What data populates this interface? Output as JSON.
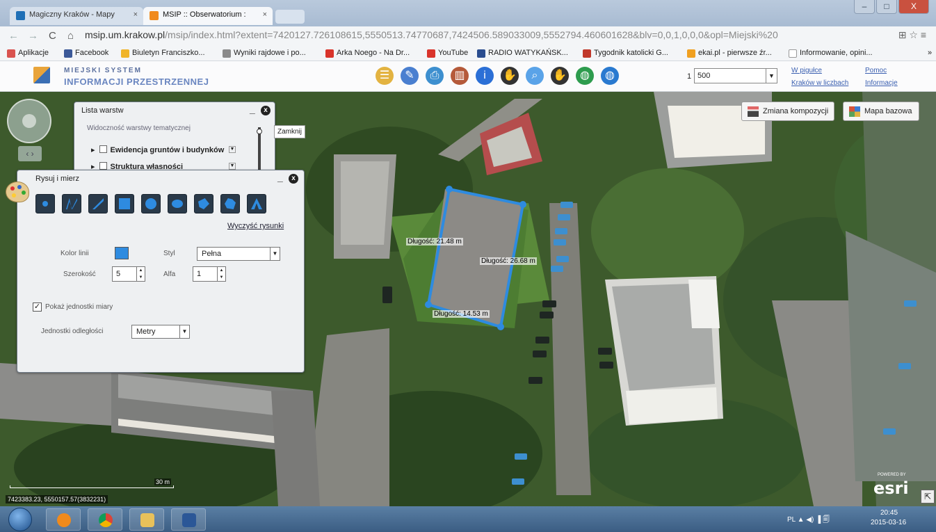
{
  "browser": {
    "tabs": [
      {
        "label": "Magiczny Kraków - Mapy",
        "close": "×"
      },
      {
        "label": "MSIP :: Obserwatorium :",
        "close": "×"
      }
    ],
    "window_buttons": {
      "minimize": "–",
      "maximize": "□",
      "close": "X"
    },
    "nav": {
      "back": "←",
      "forward": "→",
      "reload": "C",
      "home": "⌂"
    },
    "url_host": "msip.um.krakow.pl",
    "url_path": "/msip/index.html?extent=7420127.726108615,5550513.74770687,7424506.589033009,5552794.460601628&blv=0,0,1,0,0,0&opl=Miejski%20",
    "url_icons": "⊞ ☆ ≡",
    "bookmarks": [
      {
        "label": "Aplikacje",
        "color": "#d9534f"
      },
      {
        "label": "Facebook",
        "color": "#3b5998"
      },
      {
        "label": "Biuletyn Franciszko...",
        "color": "#f0b429"
      },
      {
        "label": "Wyniki rajdowe i po...",
        "color": "#8a8a8a"
      },
      {
        "label": "Arka Noego - Na Dr...",
        "color": "#d9342b"
      },
      {
        "label": "YouTube",
        "color": "#d9342b"
      },
      {
        "label": "RADIO WATYKAŃSK...",
        "color": "#2a4d8f"
      },
      {
        "label": "Tygodnik katolicki G...",
        "color": "#c0392b"
      },
      {
        "label": "ekai.pl - pierwsze źr...",
        "color": "#f0a020"
      },
      {
        "label": "Informowanie, opini...",
        "color": "#ffffff"
      }
    ],
    "bookmarks_more": "»"
  },
  "app": {
    "logo_line1": "MIEJSKI SYSTEM",
    "logo_line2": "INFORMACJI PRZESTRZENNEJ",
    "toolbar_icons": [
      "layers-icon",
      "measure-icon",
      "print-icon",
      "book-icon",
      "info-icon",
      "hand-icon",
      "search-icon",
      "identify-icon",
      "globe-icon",
      "globe-alt-icon"
    ],
    "scale_prefix": "1",
    "scale_value": "500",
    "links": {
      "w_pigulce": "W pigułce",
      "krakow_w_liczbach": "Kraków w liczbach",
      "pomoc": "Pomoc",
      "informacje": "Informacje"
    }
  },
  "map": {
    "zmiana_label": "Zmiana kompozycji",
    "mapa_label": "Mapa bazowa",
    "layers_panel": {
      "title": "Lista warstw",
      "minimize": "_",
      "close": "x",
      "subtitle": "Widoczność warstwy tematycznej",
      "rows": [
        "Ewidencja gruntów i budynków",
        "Struktura własności"
      ],
      "tooltip": "Zamknij"
    },
    "draw_panel": {
      "title": "Rysuj i mierz",
      "minimize": "_",
      "close": "x",
      "tools": [
        "point-tool-icon",
        "freehand-line-tool-icon",
        "polyline-tool-icon",
        "rectangle-tool-icon",
        "circle-tool-icon",
        "ellipse-tool-icon",
        "polygon-tool-icon",
        "freehand-polygon-tool-icon",
        "text-tool-icon"
      ],
      "clear_label": "Wyczyść rysunki",
      "color_label": "Kolor linii",
      "style_label": "Styl",
      "style_value": "Pełna",
      "width_label": "Szerokość",
      "width_value": "5",
      "alpha_label": "Alfa",
      "alpha_value": "1",
      "show_units_label": "Pokaż jednostki miary",
      "show_units_checked": "✓",
      "units_label": "Jednostki odległości",
      "units_value": "Metry"
    },
    "measurements": [
      {
        "label": "Długość: 21.48 m"
      },
      {
        "label": "Długość: 26.68 m"
      },
      {
        "label": "Długość: 14.53 m"
      }
    ],
    "scalebar_label": "30 m",
    "coords": "7423383.23, 5550157.57(3832231)",
    "esri_small": "POWERED BY",
    "esri_logo": "esri",
    "corner_icon": "⇱",
    "line_color": "#2e8be0"
  },
  "taskbar": {
    "apps": [
      "media-player-icon",
      "chrome-icon",
      "explorer-icon",
      "word-icon"
    ],
    "tray": "PL ▲ ◀) ▐ 🗐",
    "time": "20:45",
    "date": "2015-03-16"
  }
}
